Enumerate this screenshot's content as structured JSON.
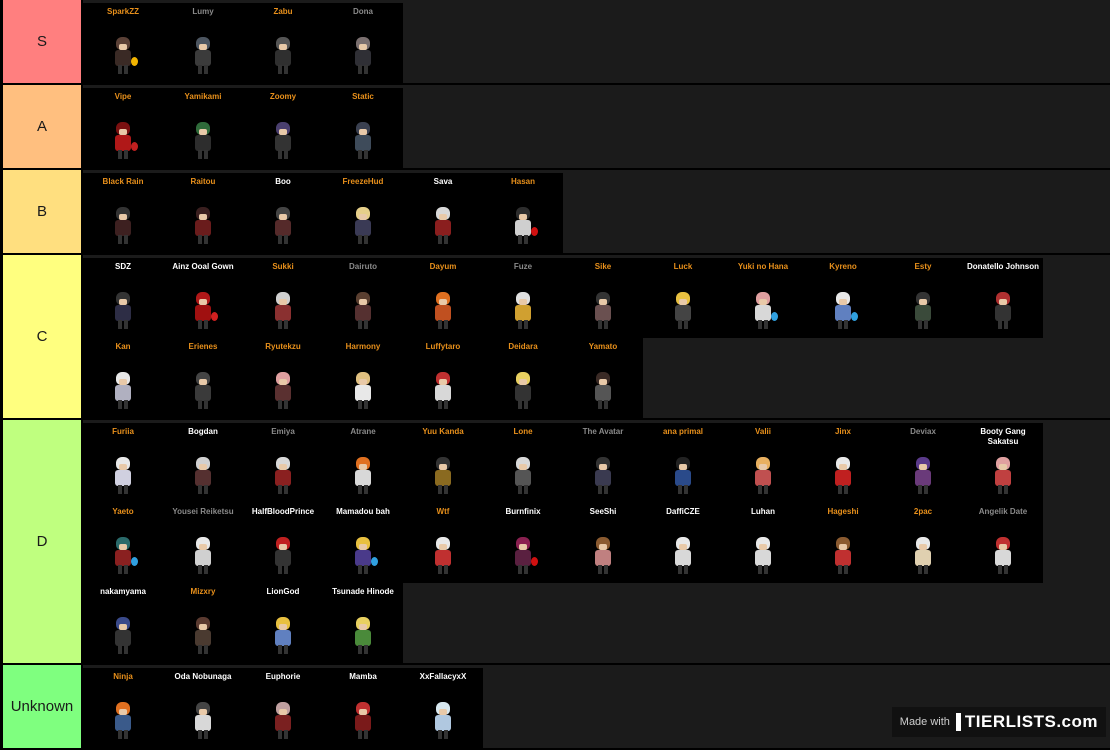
{
  "tiers": [
    {
      "label": "S",
      "color": "#ff7f7f",
      "items": [
        {
          "name": "SparkZZ",
          "color": "#e8901b",
          "hair": "#5a4036",
          "outfit": "#3a2a25",
          "fx": "#f2b400"
        },
        {
          "name": "Lumy",
          "color": "#8a8a8a",
          "hair": "#4c5560",
          "outfit": "#3b3b3b"
        },
        {
          "name": "Zabu",
          "color": "#e8901b",
          "hair": "#555",
          "outfit": "#2f2f2f"
        },
        {
          "name": "Dona",
          "color": "#8a8a8a",
          "hair": "#7a6f6f",
          "outfit": "#2f2f35"
        }
      ]
    },
    {
      "label": "A",
      "color": "#ffbf7f",
      "items": [
        {
          "name": "Vipe",
          "color": "#e8901b",
          "hair": "#7a1010",
          "outfit": "#b01818",
          "fx": "#c02020"
        },
        {
          "name": "Yamikami",
          "color": "#e8901b",
          "hair": "#2f6b3a",
          "outfit": "#2d2d2d"
        },
        {
          "name": "Zoomy",
          "color": "#e8901b",
          "hair": "#4a3f6e",
          "outfit": "#333"
        },
        {
          "name": "Static",
          "color": "#e8901b",
          "hair": "#3a4050",
          "outfit": "#3e4b5a"
        }
      ]
    },
    {
      "label": "B",
      "color": "#ffdf7f",
      "items": [
        {
          "name": "Black Rain",
          "color": "#e8901b",
          "hair": "#333",
          "outfit": "#3d2020"
        },
        {
          "name": "Raitou",
          "color": "#e8901b",
          "hair": "#3a1f1f",
          "outfit": "#6a1c1c"
        },
        {
          "name": "Boo",
          "color": "#ffffff",
          "hair": "#444",
          "outfit": "#552a2a"
        },
        {
          "name": "FreezeHud",
          "color": "#e8901b",
          "hair": "#e6cf8a",
          "outfit": "#3a3a55"
        },
        {
          "name": "Sava",
          "color": "#ffffff",
          "hair": "#d8d8d8",
          "outfit": "#8a1e1e"
        },
        {
          "name": "Hasan",
          "color": "#e8901b",
          "hair": "#2d2d2d",
          "outfit": "#cfcfcf",
          "fx": "#d01010"
        }
      ]
    },
    {
      "label": "C",
      "color": "#ffff7f",
      "items": [
        {
          "name": "SDZ",
          "color": "#ffffff",
          "hair": "#333",
          "outfit": "#2d2d45"
        },
        {
          "name": "Ainz Ooal Gown",
          "color": "#ffffff",
          "hair": "#b01818",
          "outfit": "#a01010",
          "fx": "#d02020"
        },
        {
          "name": "Sukki",
          "color": "#e8901b",
          "hair": "#d0d0d0",
          "outfit": "#8a3030"
        },
        {
          "name": "Dairuto",
          "color": "#8a8a8a",
          "hair": "#5a3f30",
          "outfit": "#553030"
        },
        {
          "name": "Dayum",
          "color": "#e8901b",
          "hair": "#e07020",
          "outfit": "#c05020"
        },
        {
          "name": "Fuze",
          "color": "#8a8a8a",
          "hair": "#e0e0e0",
          "outfit": "#d0a030"
        },
        {
          "name": "Sike",
          "color": "#e8901b",
          "hair": "#333",
          "outfit": "#6a5050"
        },
        {
          "name": "Luck",
          "color": "#e8901b",
          "hair": "#e8c040",
          "outfit": "#444"
        },
        {
          "name": "Yuki no Hana",
          "color": "#e8901b",
          "hair": "#e0a0a0",
          "outfit": "#d8d8d8",
          "fx": "#30a0e0"
        },
        {
          "name": "Kyreno",
          "color": "#e8901b",
          "hair": "#e8e8e8",
          "outfit": "#6080c0",
          "fx": "#30a0e0"
        },
        {
          "name": "Esty",
          "color": "#e8901b",
          "hair": "#333",
          "outfit": "#3a4a3a"
        },
        {
          "name": "Donatello Johnson",
          "color": "#ffffff",
          "hair": "#b03030",
          "outfit": "#333"
        },
        {
          "name": "Kan",
          "color": "#e8901b",
          "hair": "#e8e8e8",
          "outfit": "#b0b0c0"
        },
        {
          "name": "Erienes",
          "color": "#e8901b",
          "hair": "#444",
          "outfit": "#3a3a3a"
        },
        {
          "name": "Ryutekzu",
          "color": "#e8901b",
          "hair": "#e0a0a0",
          "outfit": "#5a3030"
        },
        {
          "name": "Harmony",
          "color": "#e8901b",
          "hair": "#e0c080",
          "outfit": "#e8e8e8"
        },
        {
          "name": "Luffytaro",
          "color": "#e8901b",
          "hair": "#c03030",
          "outfit": "#d8d8d8"
        },
        {
          "name": "Deidara",
          "color": "#e8901b",
          "hair": "#e8d060",
          "outfit": "#333"
        },
        {
          "name": "Yamato",
          "color": "#e8901b",
          "hair": "#3a2a25",
          "outfit": "#555"
        }
      ]
    },
    {
      "label": "D",
      "color": "#bfff7f",
      "items": [
        {
          "name": "Furiia",
          "color": "#e8901b",
          "hair": "#e8e8e8",
          "outfit": "#d0d0e0"
        },
        {
          "name": "Bogdan",
          "color": "#ffffff",
          "hair": "#d0d0d0",
          "outfit": "#553030"
        },
        {
          "name": "Emiya",
          "color": "#8a8a8a",
          "hair": "#d8d8d8",
          "outfit": "#8a2020"
        },
        {
          "name": "Atrane",
          "color": "#8a8a8a",
          "hair": "#e07020",
          "outfit": "#d8d8d8"
        },
        {
          "name": "Yuu Kanda",
          "color": "#e8901b",
          "hair": "#333",
          "outfit": "#8a6a20"
        },
        {
          "name": "Lone",
          "color": "#e8901b",
          "hair": "#d8d8d8",
          "outfit": "#555"
        },
        {
          "name": "The Avatar",
          "color": "#8a8a8a",
          "hair": "#333",
          "outfit": "#3a3a50"
        },
        {
          "name": "ana primal",
          "color": "#e8901b",
          "hair": "#222",
          "outfit": "#2a4a8a"
        },
        {
          "name": "Valii",
          "color": "#e8901b",
          "hair": "#e8b060",
          "outfit": "#c05050"
        },
        {
          "name": "Jinx",
          "color": "#e8901b",
          "hair": "#e8e8e8",
          "outfit": "#c02020"
        },
        {
          "name": "Deviax",
          "color": "#8a8a8a",
          "hair": "#5a3a8a",
          "outfit": "#6a3a7a"
        },
        {
          "name": "Booty Gang Sakatsu",
          "color": "#ffffff",
          "hair": "#e0a0a0",
          "outfit": "#c04040"
        },
        {
          "name": "Yaeto",
          "color": "#e8901b",
          "hair": "#2a6a6a",
          "outfit": "#8a2020",
          "fx": "#30a0e0"
        },
        {
          "name": "Yousei Reiketsu",
          "color": "#8a8a8a",
          "hair": "#e8e8e8",
          "outfit": "#d0d0d0"
        },
        {
          "name": "HalfBloodPrince",
          "color": "#ffffff",
          "hair": "#c02020",
          "outfit": "#333"
        },
        {
          "name": "Mamadou bah",
          "color": "#ffffff",
          "hair": "#e8c040",
          "outfit": "#4a3a8a",
          "fx": "#30a0e0"
        },
        {
          "name": "Wtf",
          "color": "#e8901b",
          "hair": "#e8e8e8",
          "outfit": "#c03030"
        },
        {
          "name": "Burnfinix",
          "color": "#ffffff",
          "hair": "#8a2050",
          "outfit": "#5a2040",
          "fx": "#d01010"
        },
        {
          "name": "SeeShi",
          "color": "#ffffff",
          "hair": "#8a5a30",
          "outfit": "#c08080"
        },
        {
          "name": "DaffiCZE",
          "color": "#ffffff",
          "hair": "#e8e8e8",
          "outfit": "#d8d8d8"
        },
        {
          "name": "Luhan",
          "color": "#ffffff",
          "hair": "#e8e8e8",
          "outfit": "#d8d8d8"
        },
        {
          "name": "Hageshi",
          "color": "#e8901b",
          "hair": "#8a5a30",
          "outfit": "#c03030"
        },
        {
          "name": "2pac",
          "color": "#e8901b",
          "hair": "#e8e8e8",
          "outfit": "#e0d0b0"
        },
        {
          "name": "Angelik Date",
          "color": "#8a8a8a",
          "hair": "#c03030",
          "outfit": "#d8d8d8"
        },
        {
          "name": "nakamyama",
          "color": "#ffffff",
          "hair": "#3a4a8a",
          "outfit": "#333"
        },
        {
          "name": "Mizxry",
          "color": "#e8901b",
          "hair": "#5a3a30",
          "outfit": "#4a3a30"
        },
        {
          "name": "LionGod",
          "color": "#ffffff",
          "hair": "#e8c040",
          "outfit": "#6080c0"
        },
        {
          "name": "Tsunade Hinode",
          "color": "#ffffff",
          "hair": "#e8d060",
          "outfit": "#4a8a3a"
        }
      ]
    },
    {
      "label": "Unknown",
      "color": "#7fff7f",
      "items": [
        {
          "name": "Ninja",
          "color": "#e8901b",
          "hair": "#e07020",
          "outfit": "#3a5a8a"
        },
        {
          "name": "Oda Nobunaga",
          "color": "#ffffff",
          "hair": "#444",
          "outfit": "#d8d8d8"
        },
        {
          "name": "Euphorie",
          "color": "#ffffff",
          "hair": "#c0a0a0",
          "outfit": "#7a2020"
        },
        {
          "name": "Mamba",
          "color": "#ffffff",
          "hair": "#c03030",
          "outfit": "#7a1a1a"
        },
        {
          "name": "XxFallacyxX",
          "color": "#ffffff",
          "hair": "#d8e8f0",
          "outfit": "#b0c8e0"
        }
      ]
    }
  ],
  "footer": {
    "made_with": "Made with",
    "brand": "TIERLISTS.com"
  }
}
